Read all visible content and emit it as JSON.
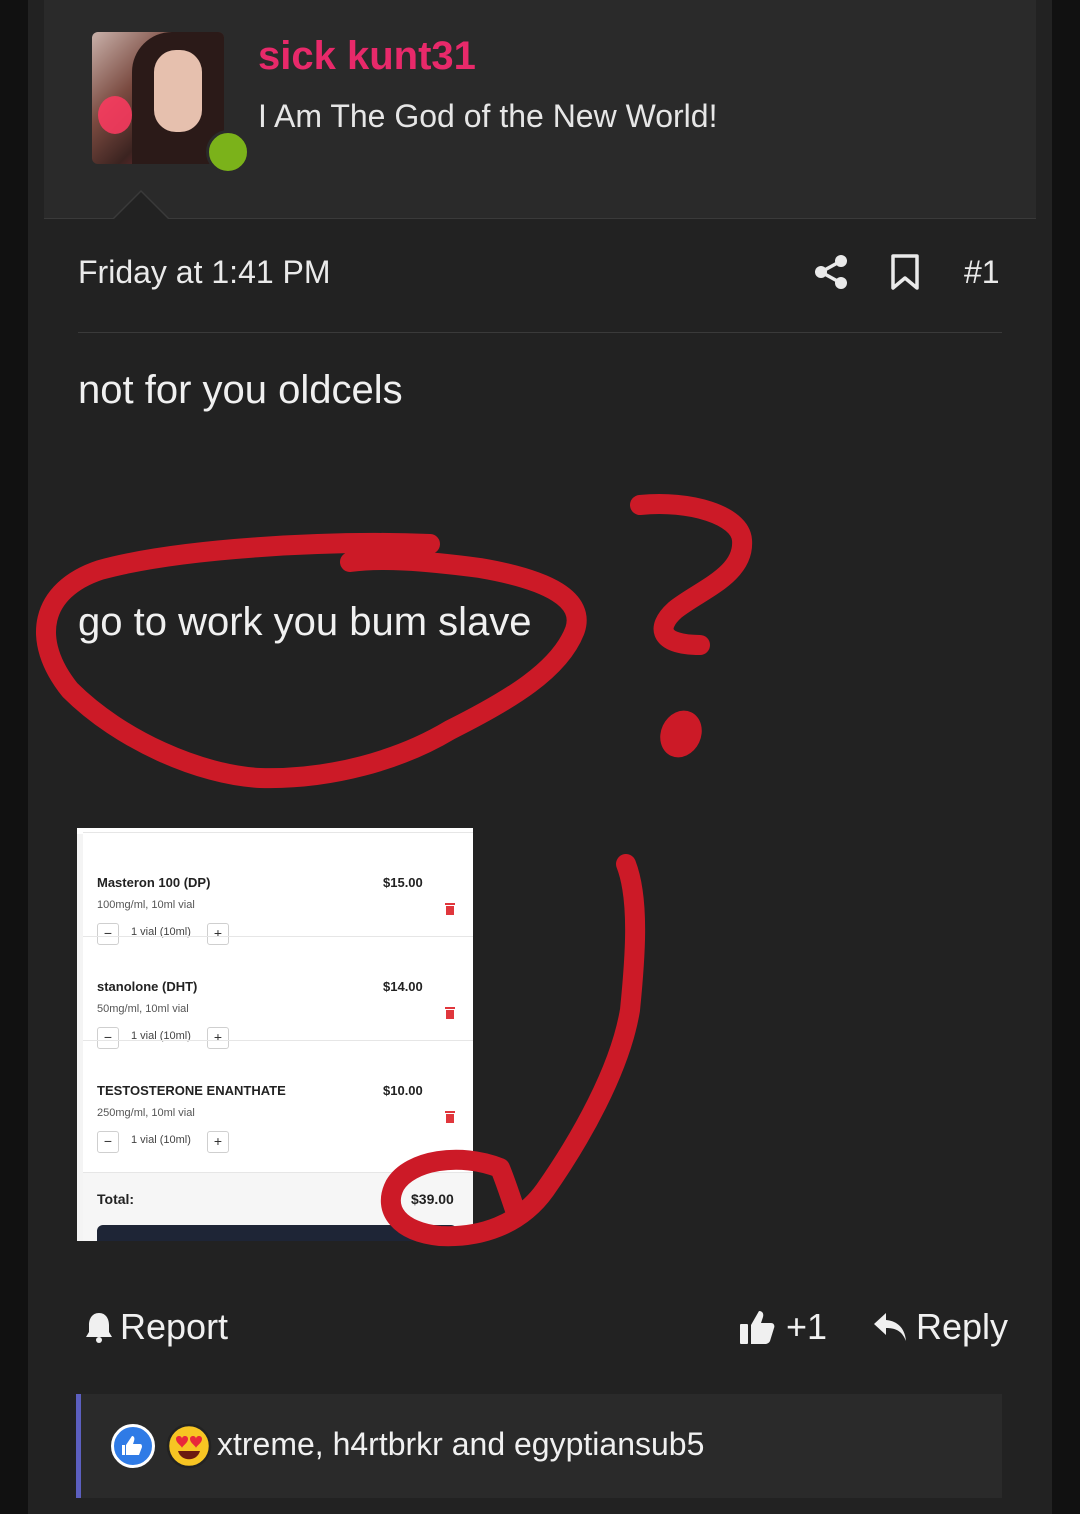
{
  "user": {
    "name": "sick kunt31",
    "title": "I Am The God of the New World!"
  },
  "post": {
    "date": "Friday at 1:41 PM",
    "number": "#1",
    "line1": "not for you oldcels",
    "line2": "go to work you bum slave"
  },
  "cart": {
    "items": [
      {
        "name": "Masteron 100 (DP)",
        "price": "$15.00",
        "desc": "100mg/ml, 10ml vial",
        "qty": "1 vial (10ml)"
      },
      {
        "name": "stanolone (DHT)",
        "price": "$14.00",
        "desc": "50mg/ml, 10ml vial",
        "qty": "1 vial (10ml)"
      },
      {
        "name": "TESTOSTERONE ENANTHATE",
        "price": "$10.00",
        "desc": "250mg/ml, 10ml vial",
        "qty": "1 vial (10ml)"
      }
    ],
    "minus": "−",
    "plus": "+",
    "total_label": "Total:",
    "total_value": "$39.00"
  },
  "actions": {
    "report": "Report",
    "like_count": "+1",
    "reply": "Reply"
  },
  "reactions": {
    "names": "xtreme, h4rtbrkr and egyptiansub5"
  },
  "colors": {
    "username": "#e8296a",
    "online": "#7bb21a",
    "annotation": "#cc1a27",
    "reaction_bar": "#5c5fbf"
  },
  "icons": [
    "share-icon",
    "bookmark-icon",
    "trash-icon",
    "bell-icon",
    "thumbs-up-icon",
    "reply-icon",
    "like-reaction-icon",
    "love-reaction-icon"
  ]
}
